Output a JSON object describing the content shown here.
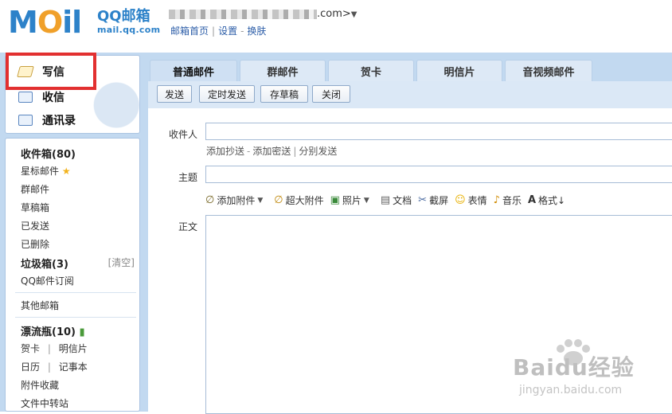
{
  "header": {
    "logo_text": "MOil",
    "logo_cn": "QQ邮箱",
    "logo_url": "mail.qq.com",
    "account_suffix": ".com>",
    "account_caret": "▼",
    "links": [
      "邮箱首页",
      "设置",
      "换肤"
    ],
    "link_seps": [
      "|",
      "-"
    ]
  },
  "sidebar": {
    "compose": "写信",
    "inbox_action": "收信",
    "contacts": "通讯录",
    "folders": [
      {
        "label": "收件箱(80)",
        "bold": true
      },
      {
        "label": "星标邮件",
        "star": "★"
      },
      {
        "label": "群邮件"
      },
      {
        "label": "草稿箱"
      },
      {
        "label": "已发送"
      },
      {
        "label": "已删除"
      },
      {
        "label": "垃圾箱(3)",
        "bold": true,
        "extra": "[清空]"
      },
      {
        "label": "QQ邮件订阅"
      }
    ],
    "other_mailbox": "其他邮箱",
    "drift_bottle": "漂流瓶(10)",
    "bottom_rows": [
      [
        "贺卡",
        "明信片"
      ],
      [
        "日历",
        "记事本"
      ]
    ],
    "row_sep": "|",
    "attachments_fav": "附件收藏",
    "file_transfer": "文件中转站"
  },
  "main": {
    "tabs": [
      "普通邮件",
      "群邮件",
      "贺卡",
      "明信片",
      "音视频邮件"
    ],
    "toolbar": [
      "发送",
      "定时发送",
      "存草稿",
      "关闭"
    ],
    "recipient_label": "收件人",
    "cc_links": [
      "添加抄送",
      "添加密送",
      "分别发送"
    ],
    "cc_seps": [
      "-",
      "|"
    ],
    "subject_label": "主题",
    "attach_items": [
      "添加附件",
      "超大附件",
      "照片",
      "文档",
      "截屏",
      "表情",
      "音乐",
      "格式↓"
    ],
    "body_label": "正文"
  },
  "watermark": {
    "big": "Baidu经验",
    "small": "jingyan.baidu.com"
  },
  "colors": {
    "frame_blue": "#c2d9f0",
    "brand_blue": "#2d82c9",
    "highlight_red": "#e23030"
  }
}
